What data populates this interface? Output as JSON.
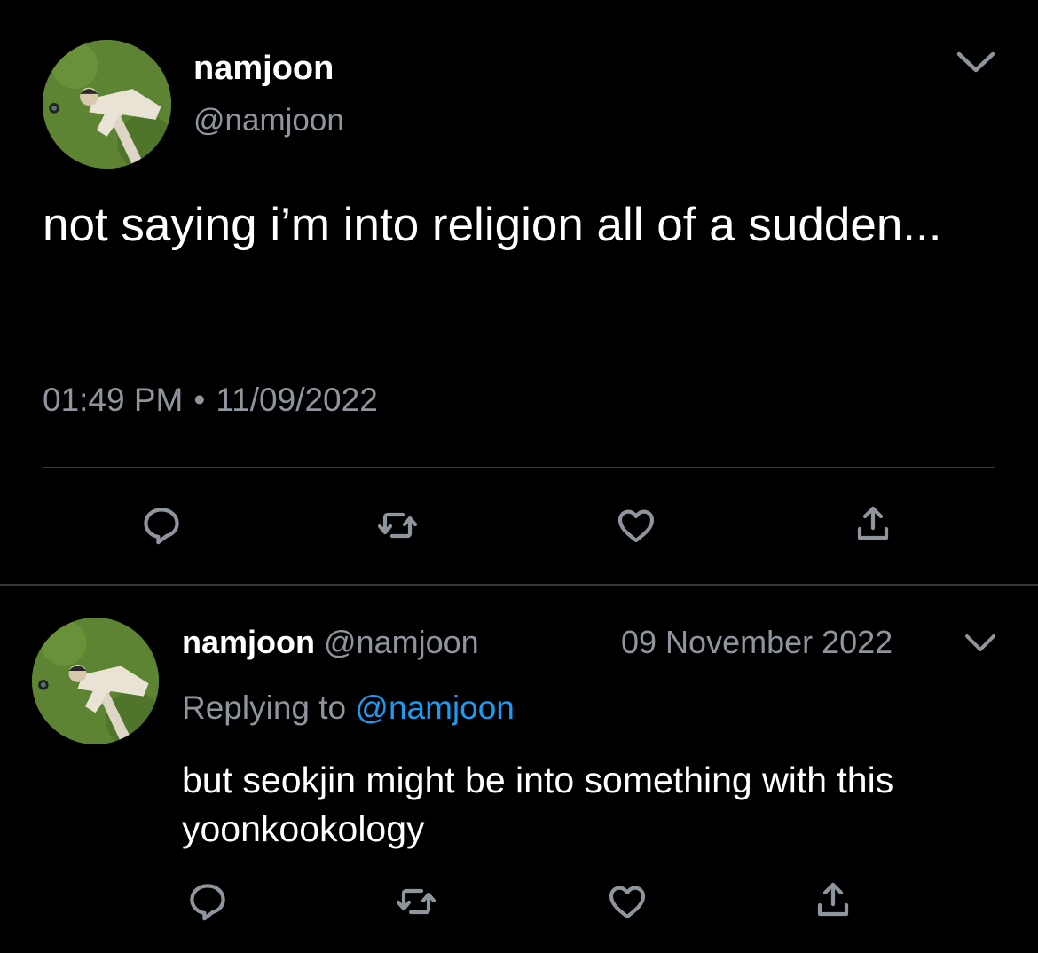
{
  "main_tweet": {
    "display_name": "namjoon",
    "handle": "@namjoon",
    "text": "not saying i’m into religion all of a sudden...",
    "time": "01:49 PM",
    "separator": "•",
    "date": "11/09/2022",
    "avatar_icon": "avatar-photo-person-lying-on-grass",
    "menu_icon": "chevron-down-icon",
    "actions": [
      "reply-icon",
      "retweet-icon",
      "like-icon",
      "share-icon"
    ]
  },
  "reply_tweet": {
    "display_name": "namjoon",
    "handle": "@namjoon",
    "date": "09 November 2022",
    "replying_label": "Replying to",
    "replying_to": "@namjoon",
    "text": "but seokjin might be into something with this yoonkookology",
    "avatar_icon": "avatar-photo-person-lying-on-grass",
    "menu_icon": "chevron-down-icon",
    "actions": [
      "reply-icon",
      "retweet-icon",
      "like-icon",
      "share-icon"
    ]
  },
  "colors": {
    "background": "#000000",
    "primary_text": "#ffffff",
    "secondary_text": "#8e959c",
    "link": "#1d9bf0",
    "divider": "#38393c",
    "icon": "#8e959c"
  }
}
